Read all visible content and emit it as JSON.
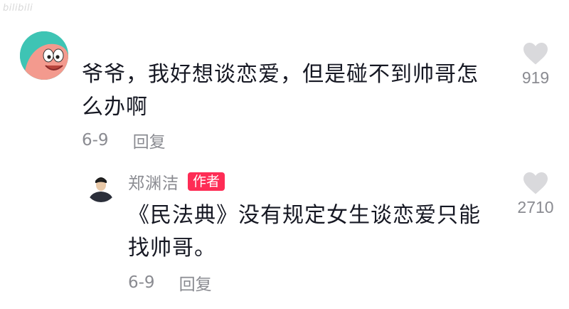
{
  "watermark": "bilibili",
  "comment": {
    "text": "爷爷，我好想谈恋爱，但是碰不到帅哥怎么办啊",
    "date": "6-9",
    "reply_label": "回复",
    "like_count": "919",
    "like_icon": "heart-icon"
  },
  "reply": {
    "username": "郑渊洁",
    "author_badge": "作者",
    "text": "《民法典》没有规定女生谈恋爱只能找帅哥。",
    "date": "6-9",
    "reply_label": "回复",
    "like_count": "2710",
    "like_icon": "heart-icon"
  },
  "colors": {
    "text_primary": "#161823",
    "text_secondary": "#8a8b91",
    "badge": "#fe2c55",
    "heart": "#d9d9dc"
  }
}
